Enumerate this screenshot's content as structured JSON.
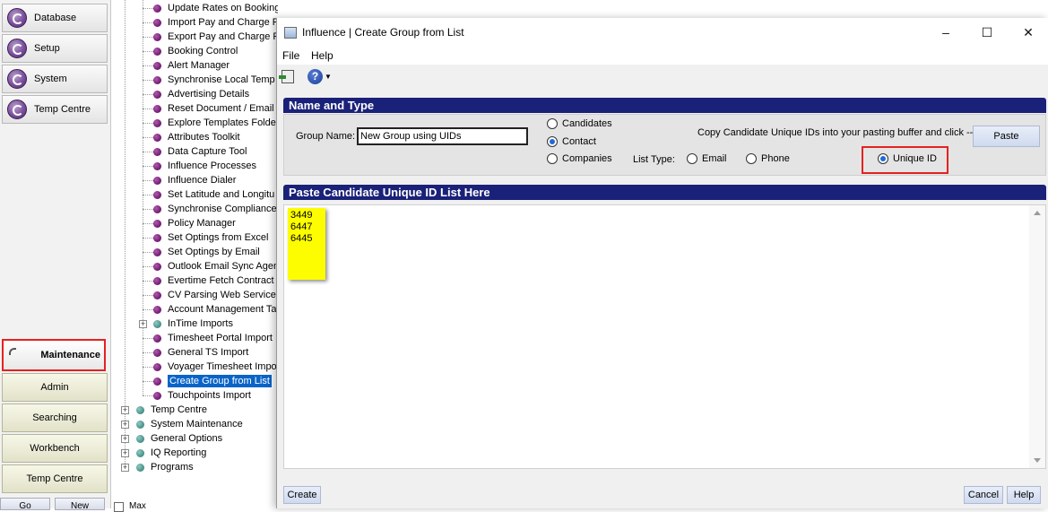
{
  "left_nav": {
    "top_items": [
      {
        "label": "Database"
      },
      {
        "label": "Setup"
      },
      {
        "label": "System"
      },
      {
        "label": "Temp Centre"
      }
    ],
    "bottom_items": [
      {
        "label": "Maintenance"
      },
      {
        "label": "Admin"
      },
      {
        "label": "Searching"
      },
      {
        "label": "Workbench"
      },
      {
        "label": "Temp Centre"
      }
    ],
    "go_label": "Go",
    "new_label": "New",
    "max_label": "Max"
  },
  "tree": {
    "children": [
      "Update Rates on Bookings",
      "Import Pay and Charge R",
      "Export Pay and Charge R",
      "Booking Control",
      "Alert Manager",
      "Synchronise Local Temp",
      "Advertising Details",
      "Reset Document / Email (",
      "Explore Templates Folde",
      "Attributes Toolkit",
      "Data Capture Tool",
      "Influence Processes",
      "Influence Dialer",
      "Set Latitude and Longitu",
      "Synchronise Compliance",
      "Policy Manager",
      "Set Optings from Excel",
      "Set Optings by Email",
      "Outlook Email Sync Agen",
      "Evertime Fetch Contract",
      "CV Parsing Web Service",
      "Account Management Ta",
      "InTime Imports",
      "Timesheet Portal Import",
      "General TS Import",
      "Voyager Timesheet Impo",
      "Create Group from List",
      "Touchpoints Import"
    ],
    "top_level": [
      "Temp Centre",
      "System Maintenance",
      "General Options",
      "IQ Reporting",
      "Programs"
    ]
  },
  "dialog": {
    "title": "Influence | Create Group from List",
    "menu": {
      "file": "File",
      "help": "Help"
    },
    "section1": "Name and Type",
    "group_name_label": "Group Name:",
    "group_name_value": "New Group using UIDs",
    "type_options": [
      "Candidates",
      "Contact",
      "Companies"
    ],
    "type_selected": "Contact",
    "copy_instruction": "Copy Candidate Unique IDs into your pasting buffer and click -->",
    "paste_label": "Paste",
    "list_type_label": "List Type:",
    "list_type_options": [
      "Email",
      "Phone",
      "Unique ID"
    ],
    "list_type_selected": "Unique ID",
    "section2": "Paste Candidate Unique ID List Here",
    "ids": [
      "3449",
      "6447",
      "6445"
    ],
    "create_label": "Create",
    "cancel_label": "Cancel",
    "help_label": "Help"
  },
  "colors": {
    "section_header": "#1a2178",
    "highlight_box": "#e32222",
    "selection": "#0a64c8",
    "sticky_note": "#fdfd00"
  }
}
